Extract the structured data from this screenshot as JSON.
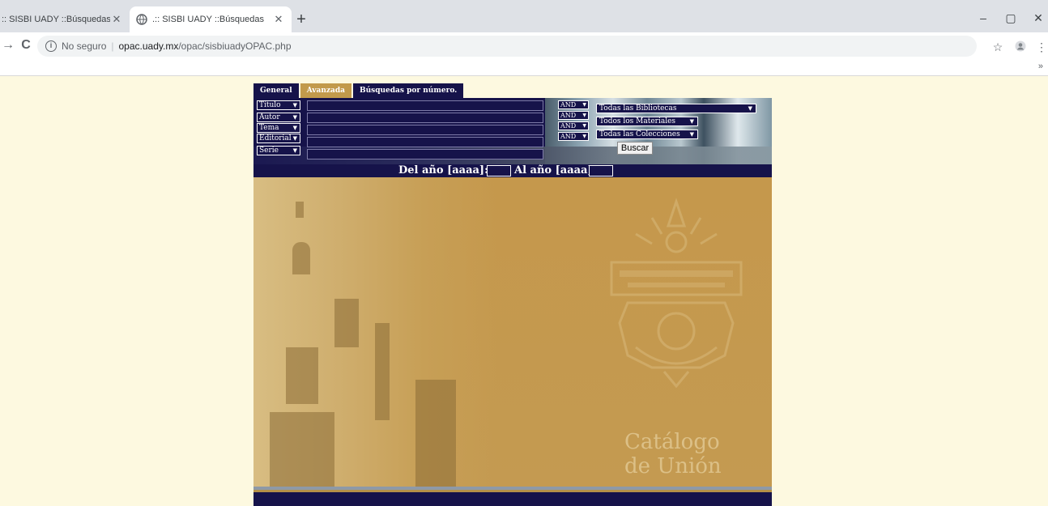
{
  "browser": {
    "tabs": [
      {
        "title": ":: SISBI UADY ::Búsquedas",
        "active": false
      },
      {
        "title": ".:: SISBI UADY ::Búsquedas",
        "active": true
      }
    ],
    "new_tab_label": "+",
    "window_controls": {
      "minimize": "–",
      "maximize": "▢",
      "close": "✕"
    },
    "nav": {
      "back": "→",
      "reload": "C"
    },
    "address": {
      "security": "No seguro",
      "separator": "|",
      "domain": "opac.uady.mx",
      "path": "/opac/sisbiuadyOPAC.php"
    },
    "bookmarks_more": "»"
  },
  "search": {
    "tabs": [
      {
        "label": "General",
        "active": false
      },
      {
        "label": "Avanzada",
        "active": true
      },
      {
        "label": "Búsquedas por número.",
        "active": false
      }
    ],
    "fields": [
      "Título",
      "Autor",
      "Tema",
      "Editorial",
      "Serie"
    ],
    "operators": [
      "AND",
      "AND",
      "AND",
      "AND"
    ],
    "libraries": "Todas las Bibliotecas",
    "materials": "Todos los Materiales",
    "collections": "Todas las Colecciones",
    "submit_label": "Buscar",
    "year_from_label": "Del año [aaaa]:",
    "year_to_label": "Al año [aaaa]:"
  },
  "branding": {
    "line1": "Catálogo",
    "line2": "de Unión"
  },
  "colors": {
    "navy": "#16134a",
    "gold": "#c29a4b",
    "page_bg": "#fdf9e0"
  }
}
